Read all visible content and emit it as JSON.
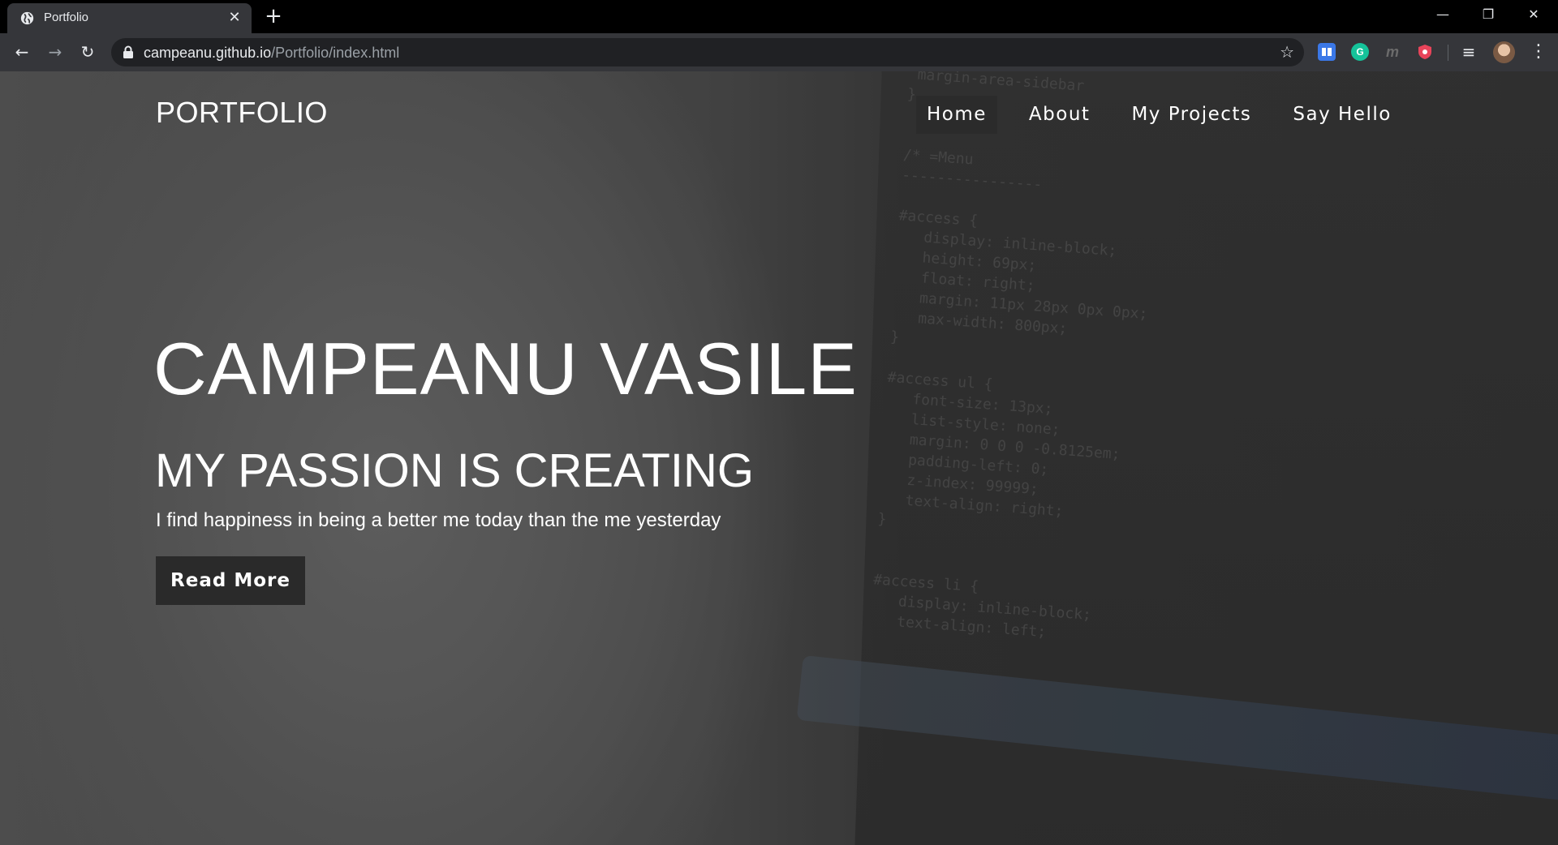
{
  "browser": {
    "tab_title": "Portfolio",
    "tab_close_glyph": "✕",
    "new_tab_glyph": "+",
    "url_host": "campeanu.github.io",
    "url_path": "/Portfolio/index.html",
    "window_controls": {
      "minimize": "—",
      "restore": "❐",
      "close": "✕"
    },
    "nav_icons": {
      "back": "←",
      "forward": "→",
      "reload": "↻"
    },
    "extensions": [
      {
        "name": "reader-extension-icon",
        "label": "",
        "color": "#3b78e7"
      },
      {
        "name": "grammarly-extension-icon",
        "label": "G",
        "color": "#15c39a"
      },
      {
        "name": "m-extension-icon",
        "label": "m",
        "color": "#35363a"
      },
      {
        "name": "shield-extension-icon",
        "label": "",
        "color": "#e8445a"
      }
    ],
    "bookmark_glyph": "☆",
    "media_glyph": "≡",
    "menu_glyph": "⋮"
  },
  "site": {
    "logo": "PORTFOLIO",
    "nav": [
      {
        "label": "Home",
        "active": true
      },
      {
        "label": "About",
        "active": false
      },
      {
        "label": "My Projects",
        "active": false
      },
      {
        "label": "Say Hello",
        "active": false
      }
    ],
    "hero": {
      "name": "CAMPEANU VASILE",
      "tagline": "MY PASSION IS CREATING",
      "subtitle": "I find happiness in being a better me today than the me yesterday",
      "button": "Read More"
    }
  }
}
